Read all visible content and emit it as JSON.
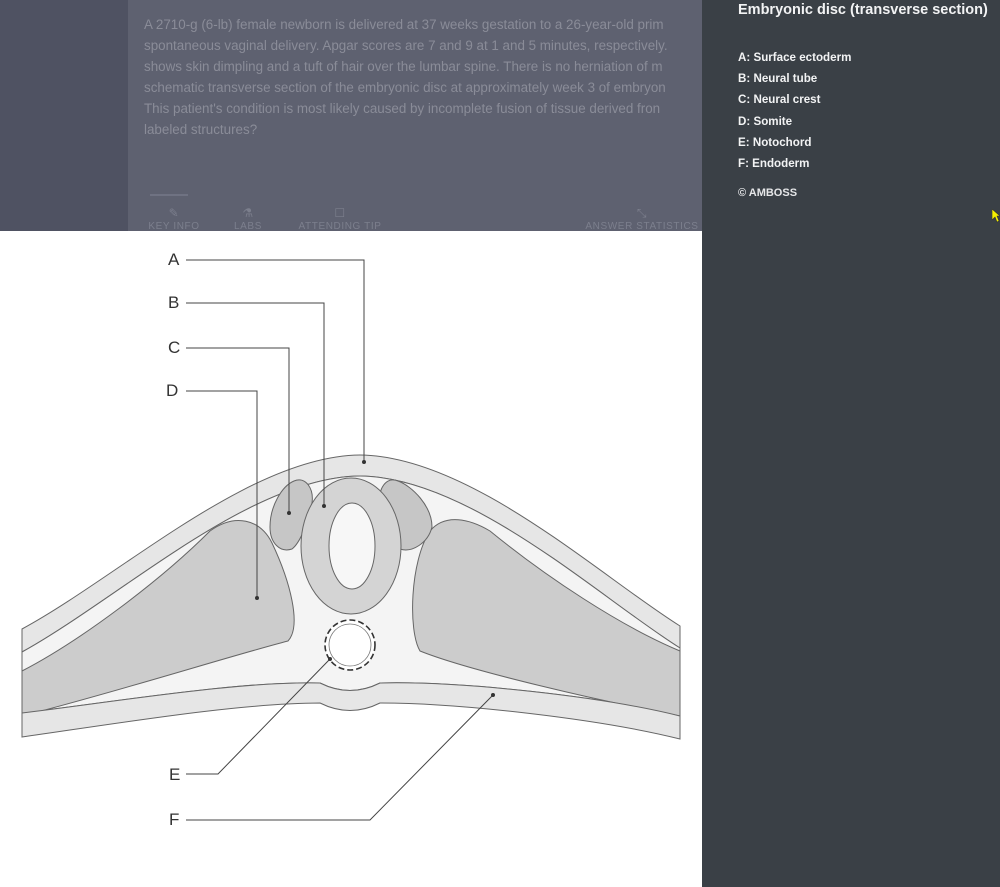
{
  "background": {
    "question_lines": [
      "A 2710-g (6-lb) female newborn is delivered at 37 weeks gestation to a 26-year-old prim",
      "spontaneous vaginal delivery. Apgar scores are 7 and 9 at 1 and 5 minutes, respectively.",
      "shows skin dimpling and a tuft of hair over the lumbar spine. There is no herniation of m",
      "schematic transverse section of the embryonic disc at approximately week 3 of embryon",
      "This patient's condition is most likely caused by incomplete fusion of tissue derived fron",
      "labeled structures?"
    ],
    "toolbar": [
      "KEY INFO",
      "LABS",
      "ATTENDING TIP",
      "ANSWER STATISTICS"
    ]
  },
  "figure": {
    "labels": [
      "A",
      "B",
      "C",
      "D",
      "E",
      "F"
    ]
  },
  "panel": {
    "title": "Embryonic disc (transverse section)",
    "items": [
      "A: Surface ectoderm",
      "B: Neural tube",
      "C: Neural crest",
      "D: Somite",
      "E: Notochord",
      "F: Endoderm"
    ],
    "copyright": "© AMBOSS"
  },
  "colors": {
    "panel_bg": "#3a4046",
    "overlay_bg": "#5e6170",
    "tissue_dark": "#c9c9c9",
    "tissue_light": "#f3f3f3",
    "outline": "#555555"
  }
}
